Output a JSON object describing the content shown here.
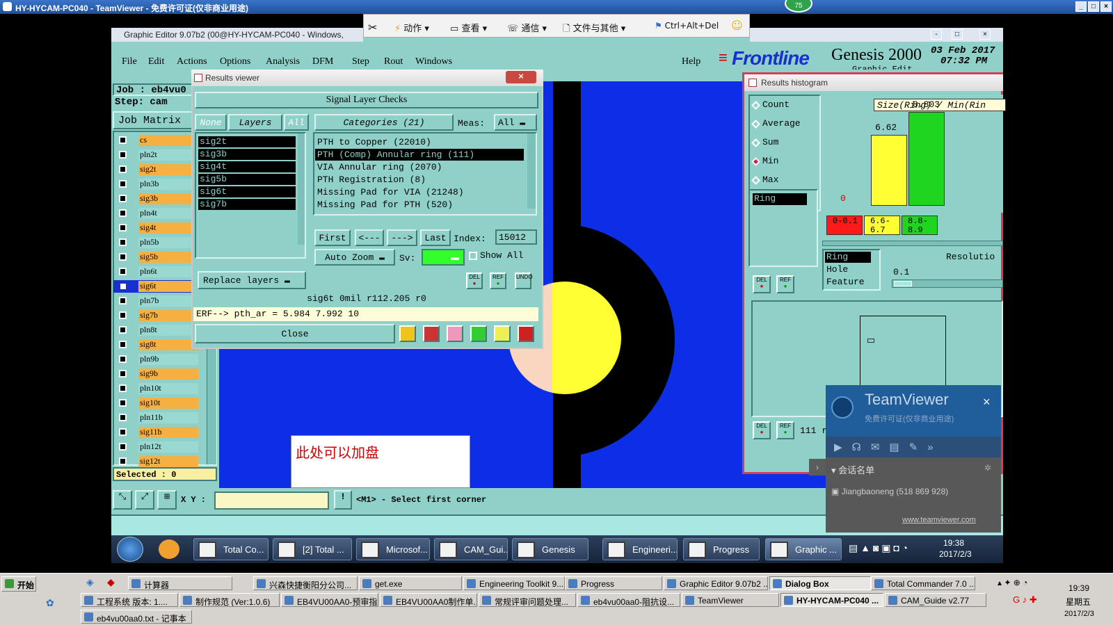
{
  "remote": {
    "title": "HY-HYCAM-PC040 - TeamViewer - 免费许可证(仅非商业用途)",
    "badge": "75",
    "toolbar": [
      "动作",
      "查看",
      "通信",
      "文件与其他",
      "Ctrl+Alt+Del"
    ]
  },
  "editor": {
    "title": "Graphic Editor 9.07b2 (00@HY-HYCAM-PC040 - Windows,",
    "menu": [
      "File",
      "Edit",
      "Actions",
      "Options",
      "Analysis",
      "DFM",
      "Step",
      "Rout",
      "Windows"
    ],
    "help": "Help",
    "brand": "Frontline",
    "product": "Genesis 2000",
    "date": "03 Feb 2017",
    "time": "07:32 PM",
    "subtitle": "Graphic Edit",
    "job_label": "Job : eb4vu0",
    "step_label": "Step: cam",
    "job_matrix": "Job Matrix",
    "selected": "Selected : 0",
    "xy_label": "X Y :",
    "status_msg": "<M1> - Select first corner",
    "note": "此处可以加盘"
  },
  "layers": [
    {
      "name": "cs",
      "color": "#f5b041",
      "on": false
    },
    {
      "name": "pln2t",
      "color": "#9ad9d2",
      "on": false
    },
    {
      "name": "sig2t",
      "color": "#f5b041",
      "on": false
    },
    {
      "name": "pln3b",
      "color": "#9ad9d2",
      "on": false
    },
    {
      "name": "sig3b",
      "color": "#f5b041",
      "on": false
    },
    {
      "name": "pln4t",
      "color": "#9ad9d2",
      "on": false
    },
    {
      "name": "sig4t",
      "color": "#f5b041",
      "on": false
    },
    {
      "name": "pln5b",
      "color": "#9ad9d2",
      "on": false
    },
    {
      "name": "sig5b",
      "color": "#f5b041",
      "on": false
    },
    {
      "name": "pln6t",
      "color": "#9ad9d2",
      "on": false
    },
    {
      "name": "sig6t",
      "color": "#f5b041",
      "on": true
    },
    {
      "name": "pln7b",
      "color": "#9ad9d2",
      "on": false
    },
    {
      "name": "sig7b",
      "color": "#f5b041",
      "on": false
    },
    {
      "name": "pln8t",
      "color": "#9ad9d2",
      "on": false
    },
    {
      "name": "sig8t",
      "color": "#f5b041",
      "on": false
    },
    {
      "name": "pln9b",
      "color": "#9ad9d2",
      "on": false
    },
    {
      "name": "sig9b",
      "color": "#f5b041",
      "on": false
    },
    {
      "name": "pln10t",
      "color": "#9ad9d2",
      "on": false
    },
    {
      "name": "sig10t",
      "color": "#f5b041",
      "on": false
    },
    {
      "name": "pln11b",
      "color": "#9ad9d2",
      "on": false
    },
    {
      "name": "sig11b",
      "color": "#f5b041",
      "on": false
    },
    {
      "name": "pln12t",
      "color": "#9ad9d2",
      "on": false
    },
    {
      "name": "sig12t",
      "color": "#f5b041",
      "on": false
    }
  ],
  "results": {
    "title": "Results viewer",
    "header": "Signal Layer Checks",
    "none": "None",
    "layers_label": "Layers",
    "all": "All",
    "categories_label": "Categories (21)",
    "meas_label": "Meas:",
    "meas_value": "All",
    "layer_list": [
      "sig2t",
      "sig3b",
      "sig4t",
      "sig5b",
      "sig6t",
      "sig7b"
    ],
    "categories": [
      "PTH to Copper (22010)",
      "PTH (Comp) Annular ring (111)",
      "VIA Annular ring (2070)",
      "PTH Registration (8)",
      "Missing Pad for VIA (21248)",
      "Missing Pad for PTH (520)"
    ],
    "nav": [
      "First",
      "<---",
      "--->",
      "Last"
    ],
    "index_label": "Index:",
    "index_value": "15012",
    "auto_zoom": "Auto Zoom",
    "sv_label": "Sv:",
    "show_all": "Show All",
    "replace_layers": "Replace layers",
    "del": "DEL",
    "ref": "REF",
    "undo": "UNDO",
    "info": "sig6t 0mil r112.205 r0",
    "erf": "ERF--> pth_ar = 5.984 7.992 10",
    "close": "Close"
  },
  "histogram": {
    "title": "Results histogram",
    "options": [
      "Count",
      "Average",
      "Sum",
      "Min",
      "Max"
    ],
    "selected_option": "Min",
    "chart_title": "Size(Ring) / Min(Rin",
    "ring": "Ring",
    "hole": "Hole",
    "feature": "Feature",
    "resolution_label": "Resolutio",
    "resolution_value": "0.1",
    "count_label": "111 r",
    "del": "DEL",
    "ref": "REF"
  },
  "chart_data": {
    "type": "bar",
    "title": "Size(Ring) / Min(Rin",
    "categories": [
      "0-0.1",
      "6.6-6.7",
      "8.8-8.9"
    ],
    "values": [
      0,
      6.62,
      8.803
    ],
    "value_labels": [
      "0",
      "6.62",
      "8.803"
    ],
    "colors": [
      "#ff1a1a",
      "#ffff33",
      "#1fd51f"
    ],
    "ylim": [
      0,
      9
    ]
  },
  "teamviewer_popup": {
    "title": "TeamViewer",
    "subtitle": "免费许可证(仅非商业用途)",
    "session": "会话名单",
    "contact": "Jiangbaoneng (518 869 928)",
    "link": "www.teamviewer.com"
  },
  "remote_taskbar": {
    "items": [
      "Total Co...",
      "[2] Total ...",
      "Microsof...",
      "CAM_Gui...",
      "Genesis",
      "Engineeri...",
      "Progress",
      "Graphic ..."
    ],
    "time": "19:38",
    "date": "2017/2/3"
  },
  "local_taskbar": {
    "start": "开始",
    "row1": [
      "计算器",
      "兴森快捷衡阳分公司...",
      "get.exe",
      "Engineering Toolkit 9....",
      "Progress",
      "Graphic Editor 9.07b2 ...",
      "Dialog Box",
      "Total Commander 7.0 ..."
    ],
    "row2": [
      "工程系统 版本: 1....",
      "制作规范 (Ver:1.0.6)",
      "EB4VU00AA0-预审指...",
      "EB4VU00AA0制作单....",
      "常规评审问题处理...",
      "eb4vu00aa0-阻抗设...",
      "TeamViewer",
      "HY-HYCAM-PC040 ...",
      "CAM_Guide v2.77"
    ],
    "row3": [
      "eb4vu00aa0.txt - 记事本"
    ],
    "time": "19:39",
    "weekday": "星期五",
    "date": "2017/2/3"
  }
}
